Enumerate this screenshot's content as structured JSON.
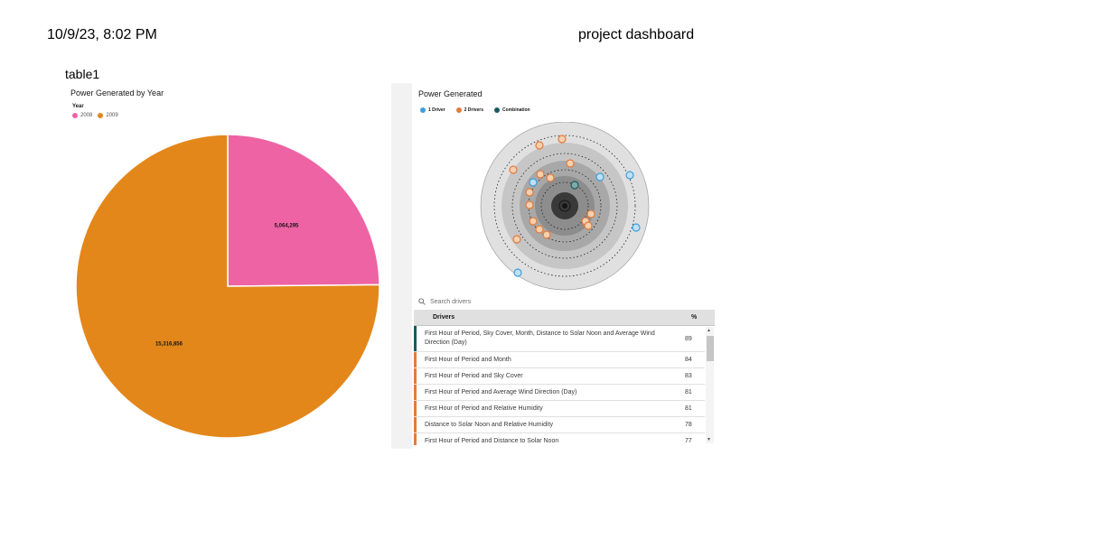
{
  "header": {
    "date": "10/9/23, 8:02 PM",
    "title": "project dashboard"
  },
  "tab_label": "table1",
  "pie": {
    "title": "Power Generated by Year",
    "legend_title": "Year",
    "legend": [
      {
        "label": "2008",
        "color": "#ee63a4"
      },
      {
        "label": "2009",
        "color": "#e3871b"
      }
    ]
  },
  "chart_data": {
    "type": "pie",
    "title": "Power Generated by Year",
    "legend_title": "Year",
    "categories": [
      "2008",
      "2009"
    ],
    "values": [
      5064295,
      15316856
    ],
    "value_labels": [
      "5,064,295",
      "15,316,856"
    ],
    "colors": [
      "#ee63a4",
      "#e3871b"
    ]
  },
  "drivers": {
    "title": "Power Generated",
    "legend": [
      {
        "label": "1 Driver",
        "color": "#3d9fdb"
      },
      {
        "label": "2 Drivers",
        "color": "#e07c3e"
      },
      {
        "label": "Combination",
        "color": "#1c5a5e"
      }
    ],
    "search_placeholder": "Search drivers",
    "col_drivers": "Drivers",
    "col_pct": "%",
    "rows": [
      {
        "label": "First Hour of Period, Sky Cover, Month, Distance to Solar Noon and Average Wind Direction (Day)",
        "pct": "89",
        "color": "#1c5a5e"
      },
      {
        "label": "First Hour of Period and Month",
        "pct": "84",
        "color": "#e07c3e"
      },
      {
        "label": "First Hour of Period and Sky Cover",
        "pct": "83",
        "color": "#e07c3e"
      },
      {
        "label": "First Hour of Period and Average Wind Direction (Day)",
        "pct": "81",
        "color": "#e07c3e"
      },
      {
        "label": "First Hour of Period and Relative Humidity",
        "pct": "81",
        "color": "#e07c3e"
      },
      {
        "label": "Distance to Solar Noon and Relative Humidity",
        "pct": "78",
        "color": "#e07c3e"
      },
      {
        "label": "First Hour of Period and Distance to Solar Noon",
        "pct": "77",
        "color": "#e07c3e"
      }
    ]
  }
}
